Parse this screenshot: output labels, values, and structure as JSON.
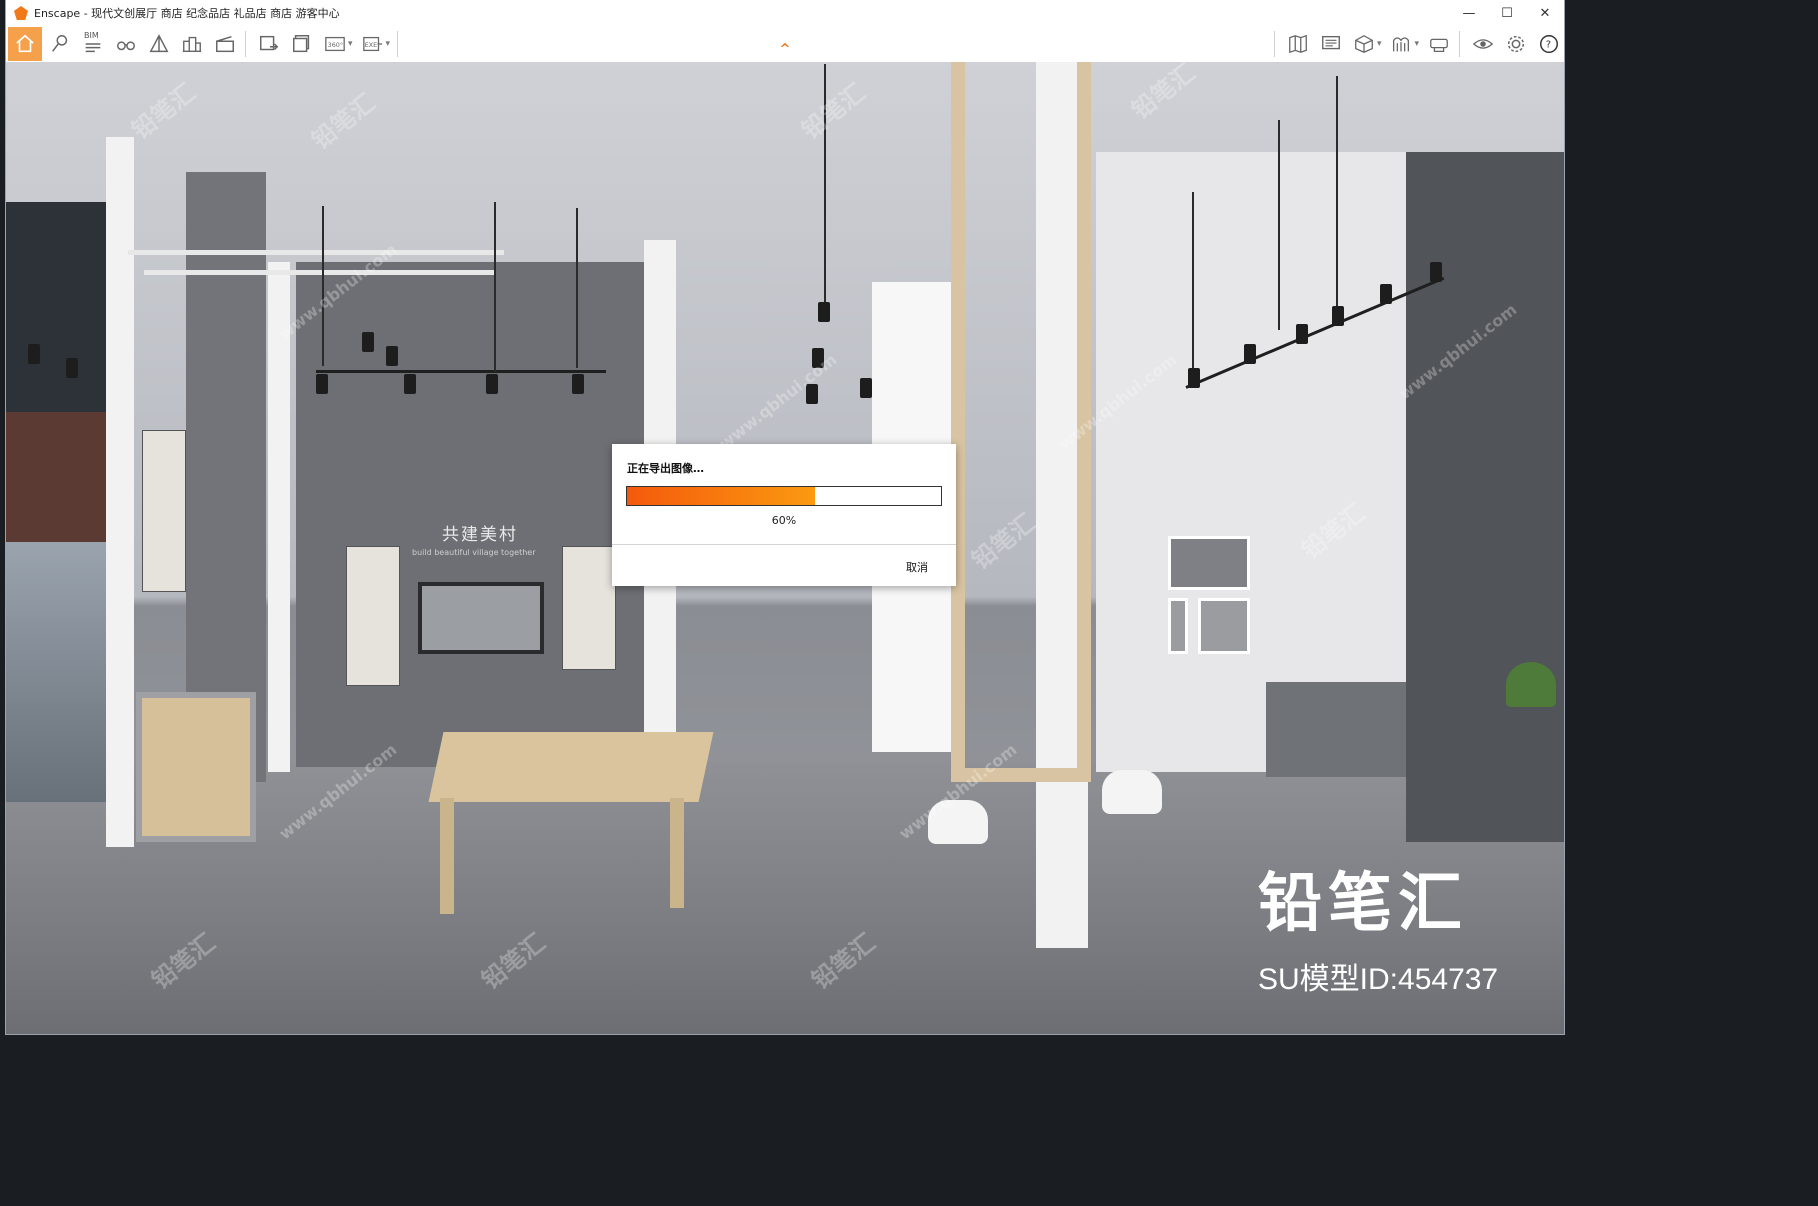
{
  "window": {
    "app_name": "Enscape",
    "title": "Enscape - 现代文创展厅 商店 纪念品店 礼品店 商店 游客中心",
    "controls": {
      "minimize": "—",
      "maximize": "☐",
      "close": "✕"
    }
  },
  "toolbar": {
    "home_icon": "home-icon",
    "bim_label": "BIM",
    "panorama_label": "360°",
    "exe_label": "EXE",
    "left_tools": [
      "home-icon",
      "location-pin-icon",
      "bim-icon",
      "binoculars-icon",
      "perspective-icon",
      "buildings-icon",
      "clapper-icon"
    ],
    "export_tools": [
      "image-export-icon",
      "batch-export-icon",
      "panorama-icon",
      "exe-export-icon"
    ],
    "right_tools": [
      "map-icon",
      "monitor-icon",
      "box-icon",
      "materials-icon",
      "vr-icon",
      "visibility-icon",
      "settings-icon",
      "help-icon"
    ],
    "collapse_icon": "^"
  },
  "scene": {
    "wall_sign": "共建美村",
    "wall_sign_sub": "build beautiful village together",
    "brand": "铅笔汇",
    "model_id": "SU模型ID:454737",
    "watermark_text": "铅笔汇",
    "watermark_url": "www.qbhui.com"
  },
  "dialog": {
    "title": "正在导出图像…",
    "progress": 60,
    "progress_label": "60%",
    "cancel_label": "取消",
    "accent_start": "#f45a0c",
    "accent_end": "#fb9a10"
  }
}
